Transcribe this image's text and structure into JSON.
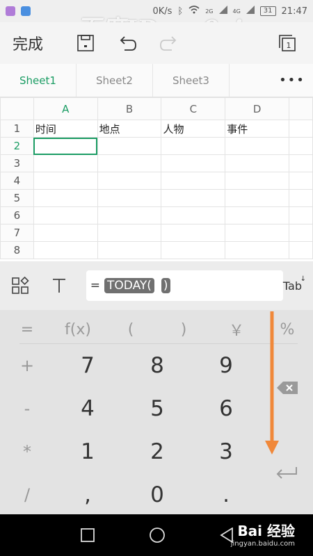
{
  "statusbar": {
    "speed": "0K/s",
    "net1": "2G",
    "net2": "4G",
    "battery": "31",
    "time": "21:47"
  },
  "watermark": {
    "top": "百度ID gu0zi",
    "brand": "Bai 经验",
    "url": "jingyan.baidu.com"
  },
  "toolbar": {
    "done_label": "完成",
    "icons": [
      "save-icon",
      "undo-icon",
      "redo-icon",
      "sheets-icon"
    ],
    "sheets_count": "1"
  },
  "tabs": {
    "items": [
      "Sheet1",
      "Sheet2",
      "Sheet3"
    ],
    "active": "Sheet1",
    "more": "•••"
  },
  "grid": {
    "columns": [
      "A",
      "B",
      "C",
      "D"
    ],
    "rows": [
      "1",
      "2",
      "3",
      "4",
      "5",
      "6",
      "7",
      "8"
    ],
    "cells": {
      "A1": "时间",
      "B1": "地点",
      "C1": "人物",
      "D1": "事件"
    },
    "selected_cell": "A2",
    "accent_color": "#1a9c63"
  },
  "formula_bar": {
    "equals": "=",
    "func_chip": "TODAY(",
    "close_chip": ")",
    "tab_label": "Tab"
  },
  "keypad": {
    "top_row": [
      "=",
      "f(x)",
      "(",
      ")",
      "￥",
      "%"
    ],
    "side": [
      "+",
      "-",
      "*",
      "/"
    ],
    "numbers": [
      "7",
      "8",
      "9",
      "4",
      "5",
      "6",
      "1",
      "2",
      "3",
      ",",
      "0",
      "."
    ],
    "arrow_color": "#f0883a"
  }
}
